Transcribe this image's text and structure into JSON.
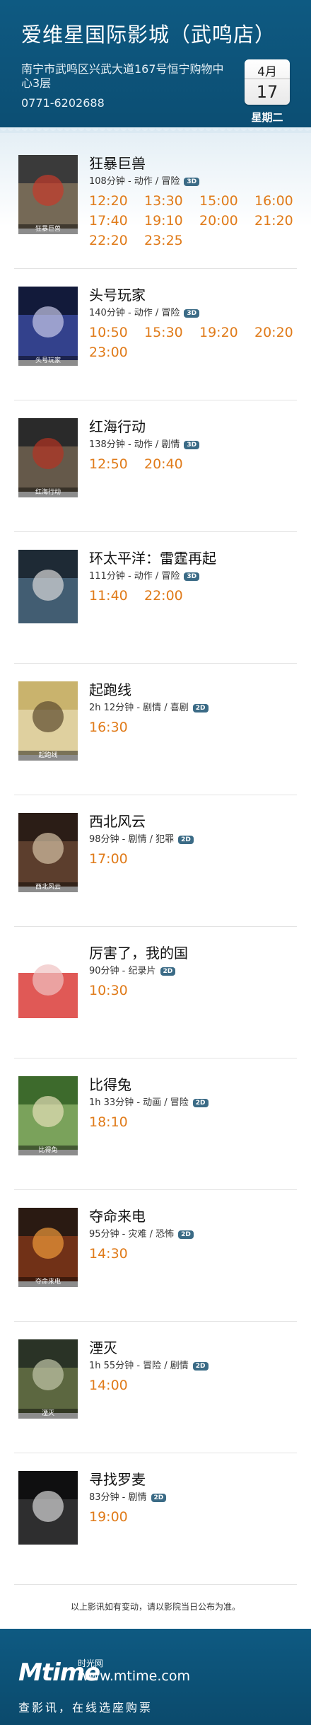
{
  "header": {
    "title": "爱维星国际影城（武鸣店）",
    "address": "南宁市武鸣区兴武大道167号恒宁购物中心3层",
    "phone": "0771-6202688",
    "calendar": {
      "month": "4月",
      "day": "17",
      "weekday": "星期二"
    }
  },
  "movies": [
    {
      "title": "狂暴巨兽",
      "meta": "108分钟 - 动作 / 冒险",
      "format": "3D",
      "poster_tag": "狂暴巨兽",
      "times": [
        "12:20",
        "13:30",
        "15:00",
        "16:00",
        "17:40",
        "19:10",
        "20:00",
        "21:20",
        "22:20",
        "23:25"
      ]
    },
    {
      "title": "头号玩家",
      "meta": "140分钟 - 动作 / 冒险",
      "format": "3D",
      "poster_tag": "头号玩家",
      "times": [
        "10:50",
        "15:30",
        "19:20",
        "20:20",
        "23:00"
      ]
    },
    {
      "title": "红海行动",
      "meta": "138分钟 - 动作 / 剧情",
      "format": "3D",
      "poster_tag": "红海行动",
      "times": [
        "12:50",
        "20:40"
      ]
    },
    {
      "title": "环太平洋：雷霆再起",
      "meta": "111分钟 - 动作 / 冒险",
      "format": "3D",
      "poster_tag": "",
      "times": [
        "11:40",
        "22:00"
      ]
    },
    {
      "title": "起跑线",
      "meta": "2h 12分钟 - 剧情 / 喜剧",
      "format": "2D",
      "poster_tag": "起跑线",
      "times": [
        "16:30"
      ]
    },
    {
      "title": "西北风云",
      "meta": "98分钟 - 剧情 / 犯罪",
      "format": "2D",
      "poster_tag": "西北风云",
      "times": [
        "17:00"
      ]
    },
    {
      "title": "厉害了，我的国",
      "meta": "90分钟 - 纪录片",
      "format": "2D",
      "poster_tag": "",
      "times": [
        "10:30"
      ]
    },
    {
      "title": "比得兔",
      "meta": "1h 33分钟 - 动画 / 冒险",
      "format": "2D",
      "poster_tag": "比得兔",
      "times": [
        "18:10"
      ]
    },
    {
      "title": "夺命来电",
      "meta": "95分钟 - 灾难 / 恐怖",
      "format": "2D",
      "poster_tag": "夺命来电",
      "times": [
        "14:30"
      ]
    },
    {
      "title": "湮灭",
      "meta": "1h 55分钟 - 冒险 / 剧情",
      "format": "2D",
      "poster_tag": "湮灭",
      "times": [
        "14:00"
      ]
    },
    {
      "title": "寻找罗麦",
      "meta": "83分钟 - 剧情",
      "format": "2D",
      "poster_tag": "",
      "times": [
        "19:00"
      ]
    }
  ],
  "footnote": "以上影讯如有变动，请以影院当日公布为准。",
  "footer": {
    "logo": "Mtime",
    "brand": "时光网",
    "site": "www.mtime.com",
    "slogan": "查影讯，在线选座购票"
  },
  "colors": {
    "header_bg": "#0e5a82",
    "showtime": "#e07b1a",
    "badge": "#3b6b86"
  },
  "poster_palettes": [
    [
      "#3a3a3a",
      "#8a7a60",
      "#c63b2b"
    ],
    [
      "#121a3a",
      "#3f4fa8",
      "#c7c9e8"
    ],
    [
      "#2a2a2a",
      "#7a6a55",
      "#b53322"
    ],
    [
      "#1e2a35",
      "#4f6f87",
      "#d9d9d9"
    ],
    [
      "#c9b36d",
      "#e6d9b0",
      "#5b4a2e"
    ],
    [
      "#2b1d16",
      "#6d4a36",
      "#d6c2a5"
    ],
    [
      "#ffffff",
      "#d6221e",
      "#f0c2c2"
    ],
    [
      "#3d6a2c",
      "#8fb66b",
      "#e6e0b8"
    ],
    [
      "#2a1a12",
      "#8a3a1a",
      "#f09a3a"
    ],
    [
      "#2a3326",
      "#6d7a4a",
      "#c2c6a8"
    ],
    [
      "#0f0f10",
      "#3a3a3a",
      "#d7d7d7"
    ]
  ]
}
